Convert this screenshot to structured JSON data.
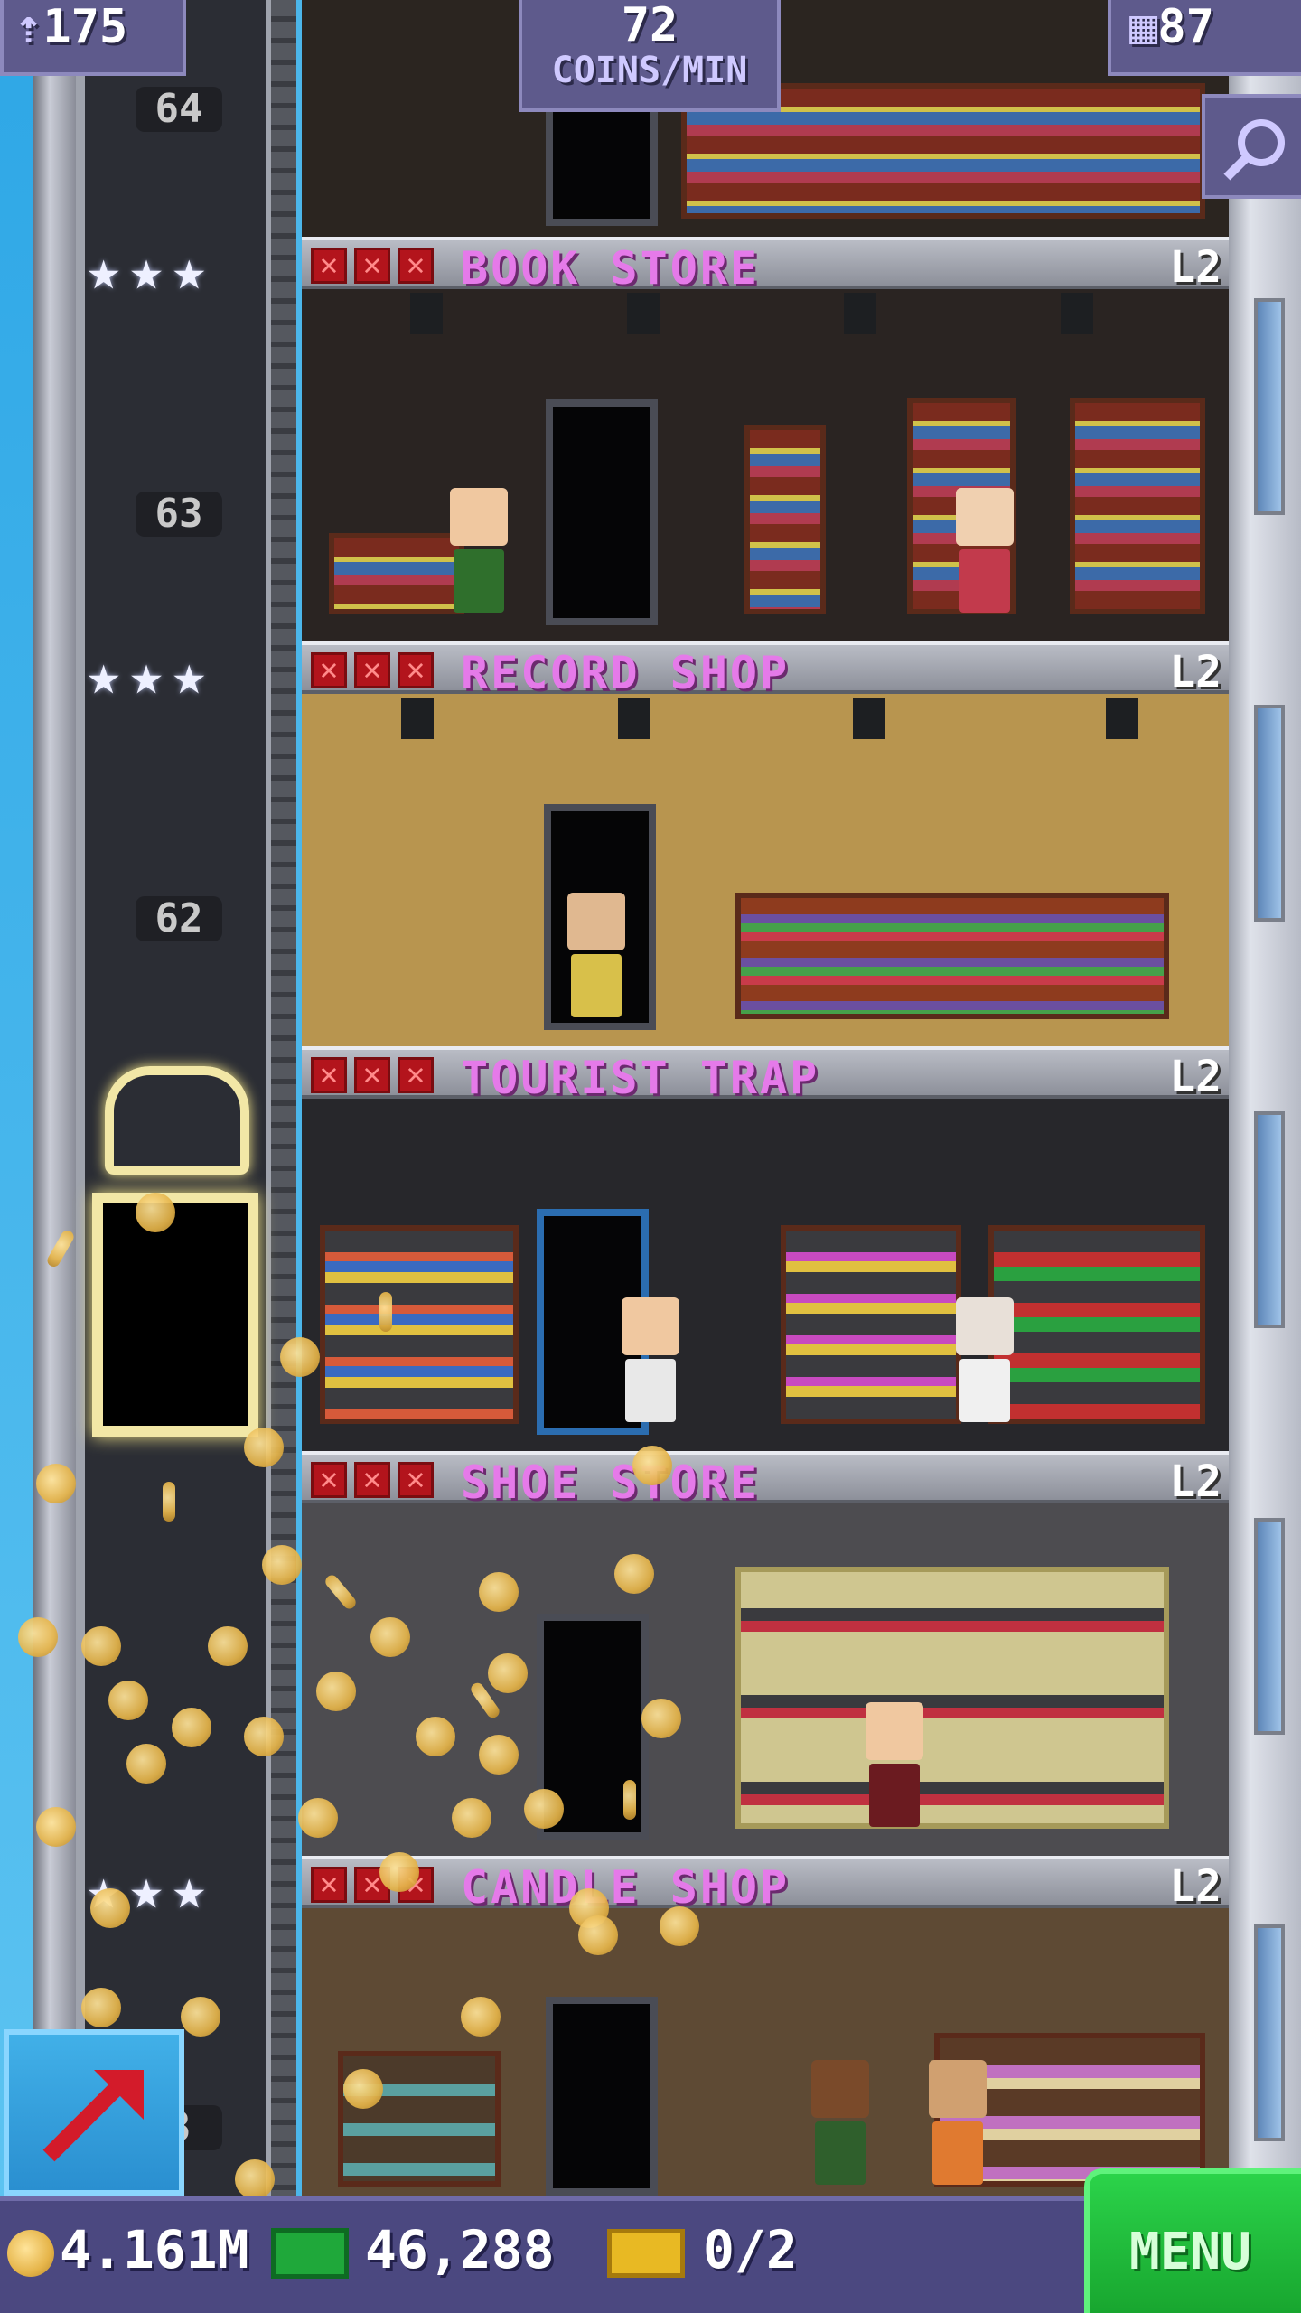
{
  "header": {
    "population": "175",
    "coins_per_min_value": "72",
    "coins_per_min_label": "COINS/MIN",
    "floors_count": "87"
  },
  "elevator_floor_numbers": [
    "64",
    "63",
    "62",
    "8"
  ],
  "floors": [
    {
      "name": "BOOK STORE",
      "level": "L2",
      "marks": 3,
      "theme": "#2a2422"
    },
    {
      "name": "RECORD SHOP",
      "level": "L2",
      "marks": 3,
      "theme": "#b8954f"
    },
    {
      "name": "TOURIST TRAP",
      "level": "L2",
      "marks": 3,
      "theme": "#27272b"
    },
    {
      "name": "SHOE STORE",
      "level": "L2",
      "marks": 3,
      "theme": "#4d4c50"
    },
    {
      "name": "CANDLE SHOP",
      "level": "L2",
      "marks": 3,
      "theme": "#5e4a34"
    }
  ],
  "bottom_bar": {
    "coins": "4.161M",
    "bux": "46,288",
    "tickets": "0/2",
    "menu_label": "MENU"
  },
  "icons": {
    "population": "person-up-icon",
    "floors": "building-icon",
    "search": "magnifier-icon",
    "coin": "coin-icon",
    "bux": "cash-icon",
    "ticket": "ticket-icon",
    "share": "arrow-up-right-icon"
  }
}
